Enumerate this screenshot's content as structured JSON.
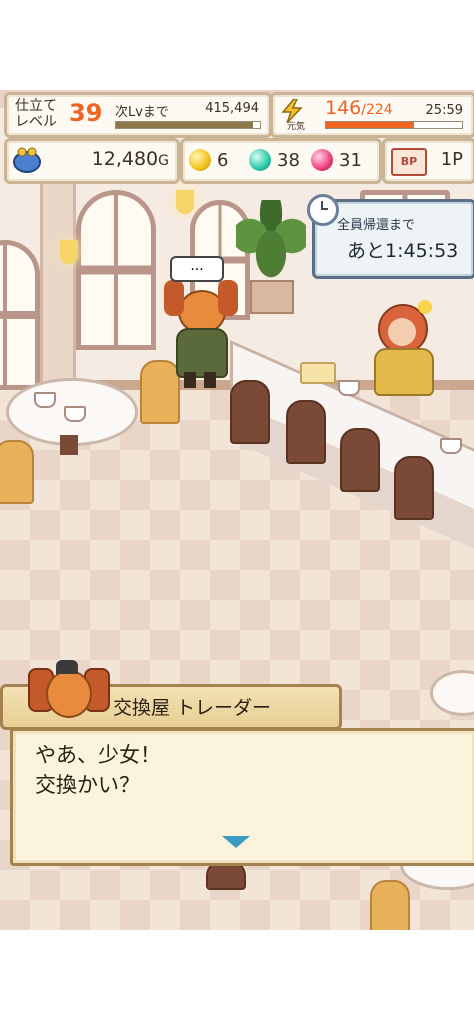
{
  "hud": {
    "level_label_line1": "仕立て",
    "level_label_line2": "レベル",
    "level_value": "39",
    "next_level_label": "次Lvまで",
    "next_level_exp": "415,494",
    "level_progress": 0.95,
    "stamina_label": "元気",
    "stamina_current": "146",
    "stamina_max": "/224",
    "stamina_timer": "25:59",
    "stamina_progress": 0.65,
    "gold_amount": "12,480",
    "gold_unit": "G",
    "yellow_gems": "6",
    "teal_gems": "38",
    "pink_gems": "31",
    "bp_icon_text": "BP",
    "bp_amount": "1P"
  },
  "timer": {
    "label": "全員帰還まで",
    "value": "あと1:45:53"
  },
  "dialog": {
    "speaker": "交換屋 トレーダー",
    "line1": "やあ、少女！",
    "line2": "交換かい？"
  },
  "npc_bubble": "...",
  "colors": {
    "accent_orange": "#ee6420",
    "panel_border": "#c9b495",
    "dialog_border": "#a3824f",
    "timer_border": "#5b6f87",
    "next_arrow": "#3a9bc4"
  },
  "icons": [
    "wallet-icon",
    "yellow-gem-icon",
    "teal-gem-icon",
    "pink-gem-icon",
    "bp-icon",
    "lightning-icon",
    "clock-icon",
    "next-arrow-icon"
  ]
}
